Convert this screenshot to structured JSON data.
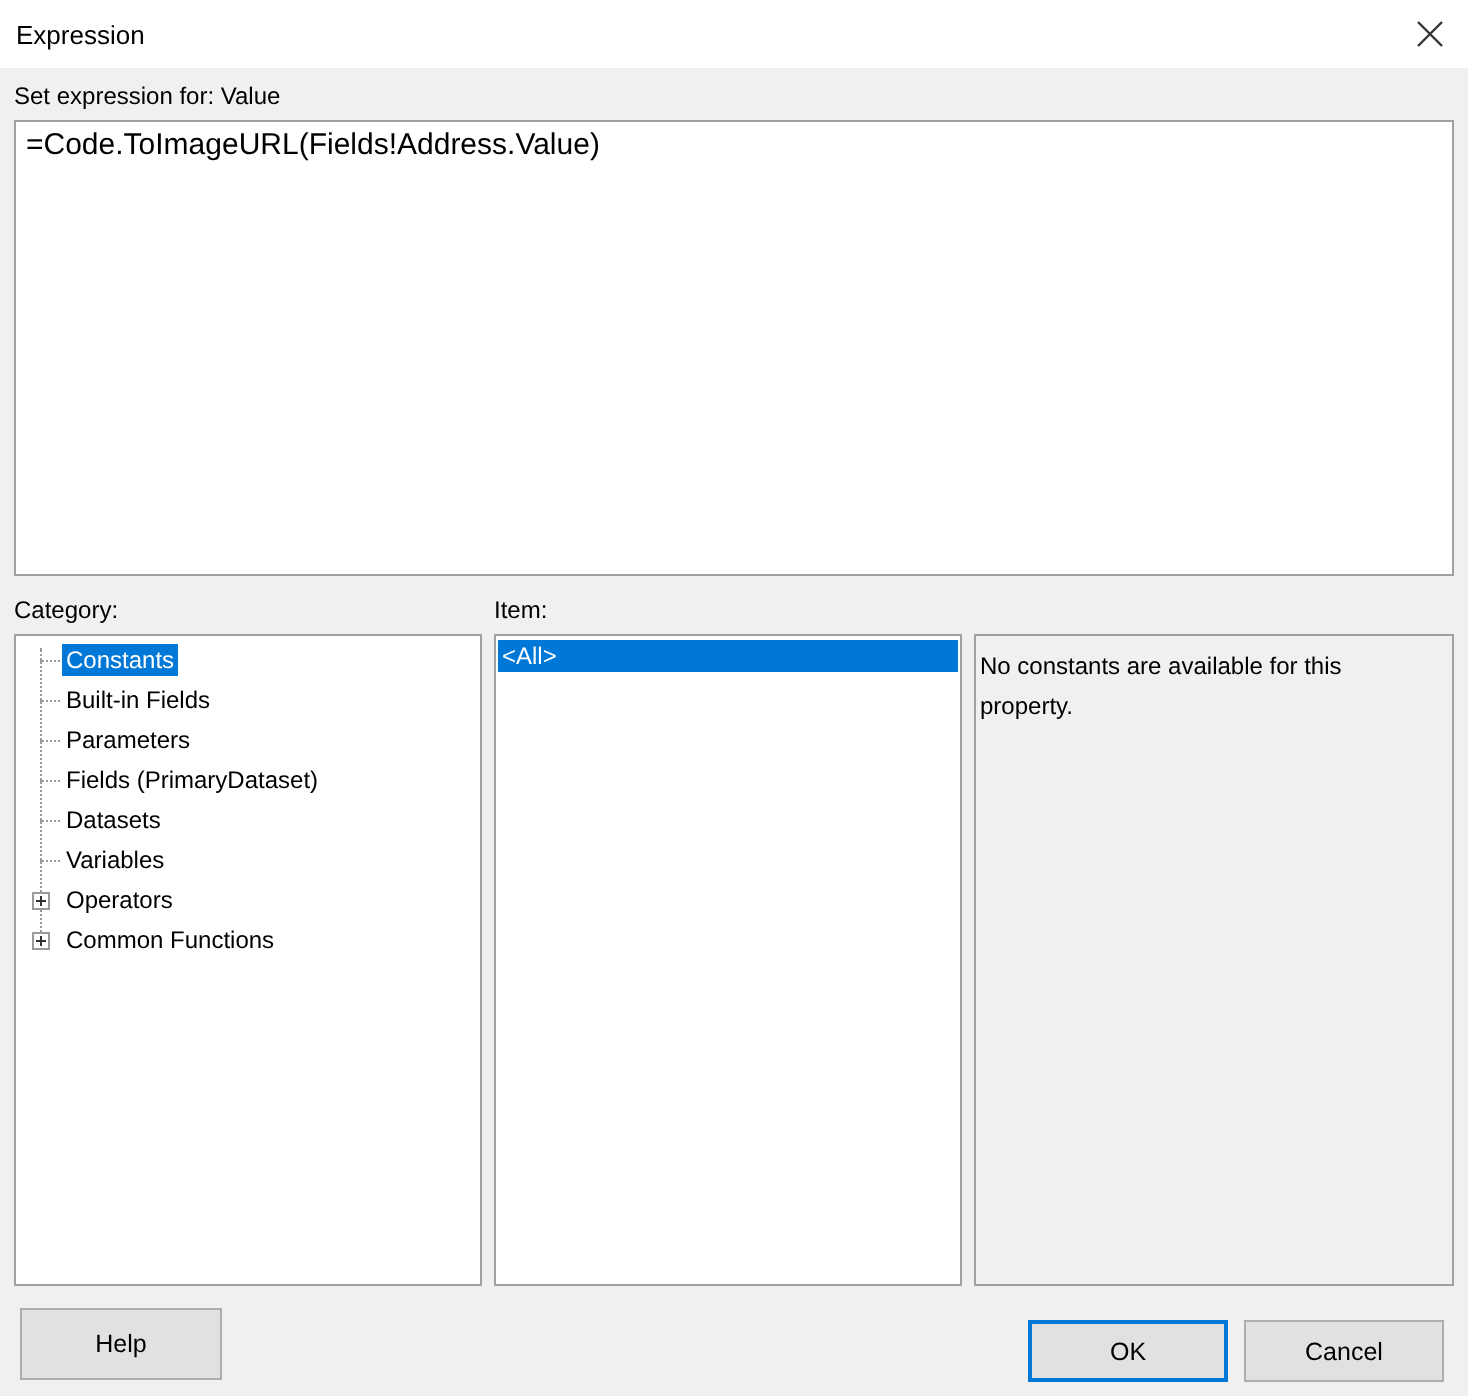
{
  "window": {
    "title": "Expression"
  },
  "expression": {
    "label": "Set expression for: Value",
    "value": "=Code.ToImageURL(Fields!Address.Value)"
  },
  "category": {
    "label": "Category:",
    "items": [
      {
        "label": "Constants",
        "selected": true,
        "expandable": false
      },
      {
        "label": "Built-in Fields",
        "selected": false,
        "expandable": false
      },
      {
        "label": "Parameters",
        "selected": false,
        "expandable": false
      },
      {
        "label": "Fields (PrimaryDataset)",
        "selected": false,
        "expandable": false
      },
      {
        "label": "Datasets",
        "selected": false,
        "expandable": false
      },
      {
        "label": "Variables",
        "selected": false,
        "expandable": false
      },
      {
        "label": "Operators",
        "selected": false,
        "expandable": true
      },
      {
        "label": "Common Functions",
        "selected": false,
        "expandable": true
      }
    ]
  },
  "item": {
    "label": "Item:",
    "items": [
      {
        "label": "<All>",
        "selected": true
      }
    ]
  },
  "description": "No constants are available for this property.",
  "buttons": [
    {
      "label": "Help",
      "default": false
    },
    {
      "label": "OK",
      "default": true
    },
    {
      "label": "Cancel",
      "default": false
    }
  ]
}
